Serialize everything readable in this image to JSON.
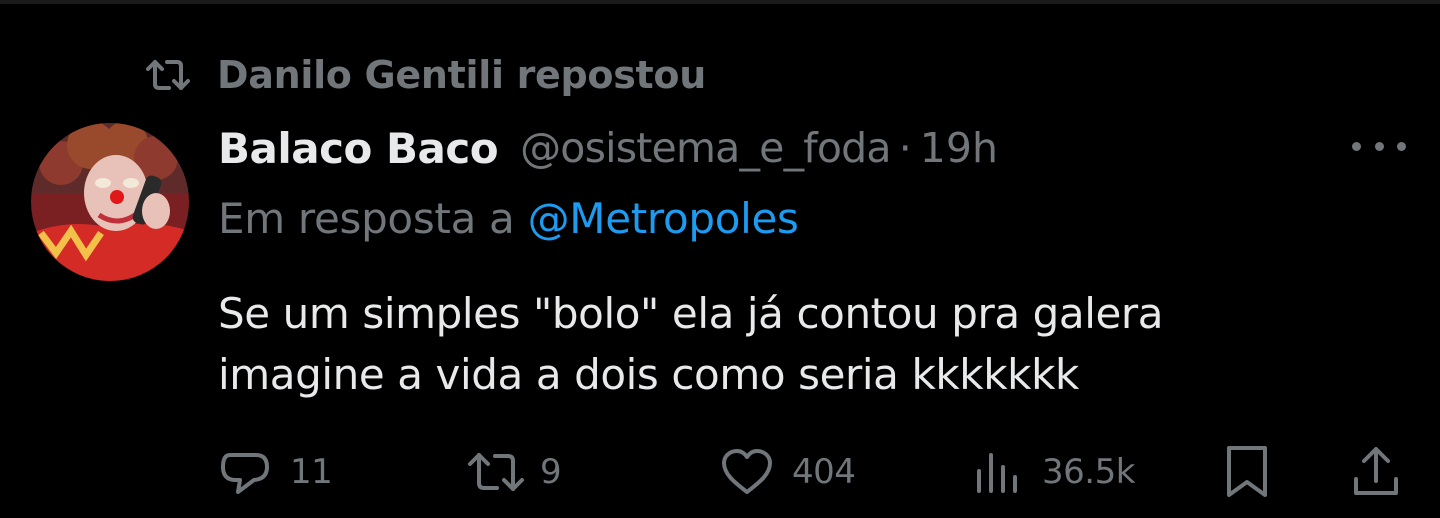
{
  "repost": {
    "text": "Danilo Gentili repostou",
    "icon": "repost-icon"
  },
  "tweet": {
    "display_name": "Balaco Baco",
    "handle": "@osistema_e_foda",
    "separator": "·",
    "time": "19h",
    "reply_prefix": "Em resposta a",
    "reply_handle": "@Metropoles",
    "body_lines": [
      "Se um simples \"bolo\" ela já contou pra galera",
      "imagine a vida a dois como seria kkkkkkk"
    ]
  },
  "actions": {
    "reply_count": "11",
    "repost_count": "9",
    "like_count": "404",
    "views_count": "36.5k"
  },
  "colors": {
    "background": "#000000",
    "primary_text": "#e7e9ea",
    "secondary_text": "#71767b",
    "link": "#1d9bf0"
  }
}
